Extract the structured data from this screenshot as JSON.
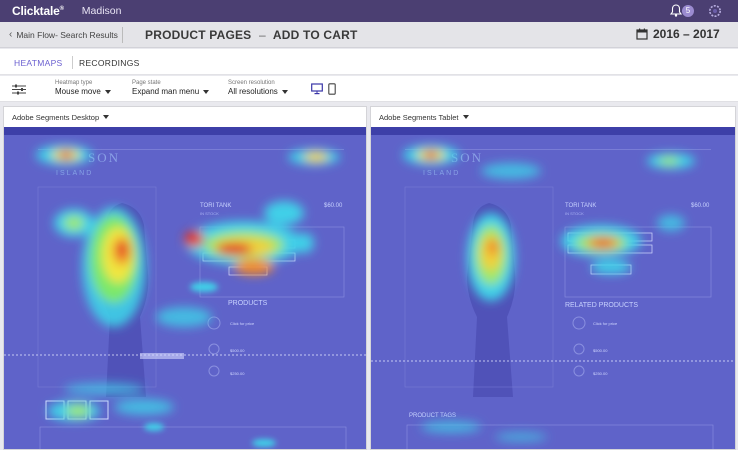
{
  "app": {
    "logo": "Clicktale",
    "account": "Madison",
    "notifications": "5"
  },
  "header": {
    "breadcrumb": "Main Flow- Search Results",
    "title_left": "PRODUCT PAGES",
    "title_sep": "–",
    "title_right": "ADD TO CART",
    "date_range": "2016 – 2017"
  },
  "tabs": [
    {
      "label": "HEATMAPS",
      "active": true
    },
    {
      "label": "RECORDINGS",
      "active": false
    }
  ],
  "controls": {
    "heatmap_type": {
      "label": "Heatmap type",
      "value": "Mouse move"
    },
    "page_state": {
      "label": "Page state",
      "value": "Expand man menu"
    },
    "resolution": {
      "label": "Screen resolution",
      "value": "All resolutions"
    }
  },
  "panels": [
    {
      "segment": "Adobe Segments Desktop",
      "site_brand": [
        "SON",
        "ISLAND"
      ],
      "product_name": "TORI TANK",
      "product_price": "$60.00",
      "stock": "IN STOCK",
      "related_heading": "PRODUCTS",
      "related_items": [
        {
          "name": "Click for price",
          "price": ""
        },
        {
          "name": "",
          "price": "$500.00"
        },
        {
          "name": "",
          "price": "$250.00"
        }
      ]
    },
    {
      "segment": "Adobe Segments Tablet",
      "site_brand": [
        "SON",
        "ISLAND"
      ],
      "product_name": "TORI TANK",
      "product_price": "$60.00",
      "stock": "IN STOCK",
      "related_heading": "RELATED PRODUCTS",
      "related_items": [
        {
          "name": "Click for price",
          "price": ""
        },
        {
          "name": "",
          "price": "$500.00"
        },
        {
          "name": "",
          "price": "$250.00"
        }
      ],
      "tags_heading": "PRODUCT TAGS"
    }
  ],
  "colors": {
    "topbar": "#4b3f72",
    "accent": "#6a5fd0",
    "heatmap_base": "#5f63c9"
  }
}
